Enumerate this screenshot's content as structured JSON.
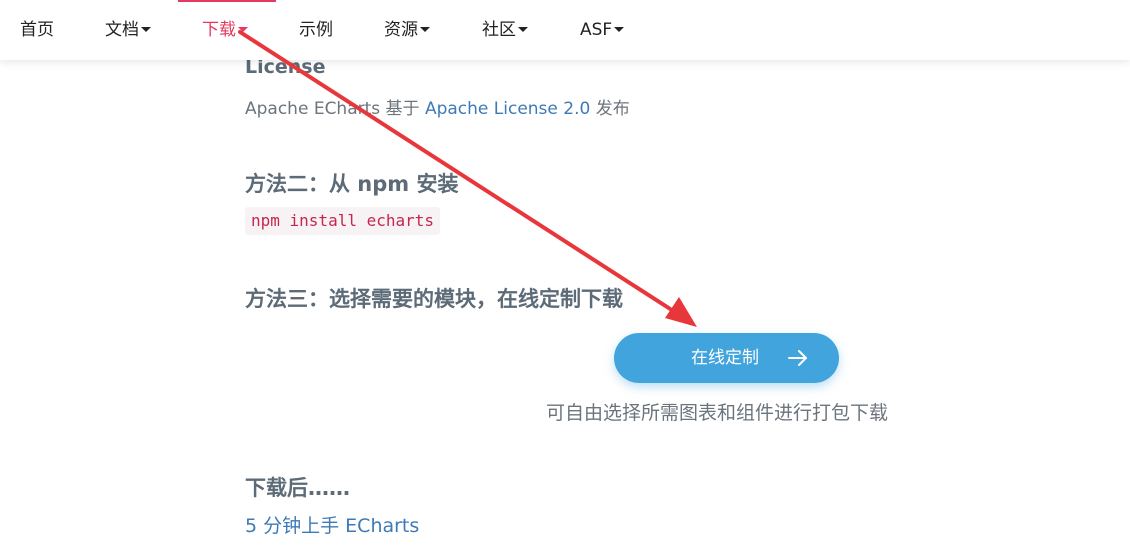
{
  "nav": {
    "items": [
      {
        "label": "首页",
        "dropdown": false,
        "active": false
      },
      {
        "label": "文档",
        "dropdown": true,
        "active": false
      },
      {
        "label": "下载",
        "dropdown": true,
        "active": true
      },
      {
        "label": "示例",
        "dropdown": false,
        "active": false
      },
      {
        "label": "资源",
        "dropdown": true,
        "active": false
      },
      {
        "label": "社区",
        "dropdown": true,
        "active": false
      },
      {
        "label": "ASF",
        "dropdown": true,
        "active": false
      }
    ],
    "active_color": "#e43961"
  },
  "license": {
    "heading": "License",
    "text_before": "Apache ECharts 基于 ",
    "link": "Apache License 2.0",
    "text_after": " 发布"
  },
  "method2": {
    "heading": "方法二：从 npm 安装",
    "code": "npm install echarts"
  },
  "method3": {
    "heading": "方法三：选择需要的模块，在线定制下载",
    "button_label": "在线定制",
    "button_icon": "arrow-right-icon",
    "button_color": "#42a4dd",
    "description": "可自由选择所需图表和组件进行打包下载"
  },
  "after": {
    "heading": "下载后……",
    "link": "5 分钟上手 ECharts"
  },
  "annotation": {
    "type": "red-arrow",
    "color": "#e8373b"
  }
}
